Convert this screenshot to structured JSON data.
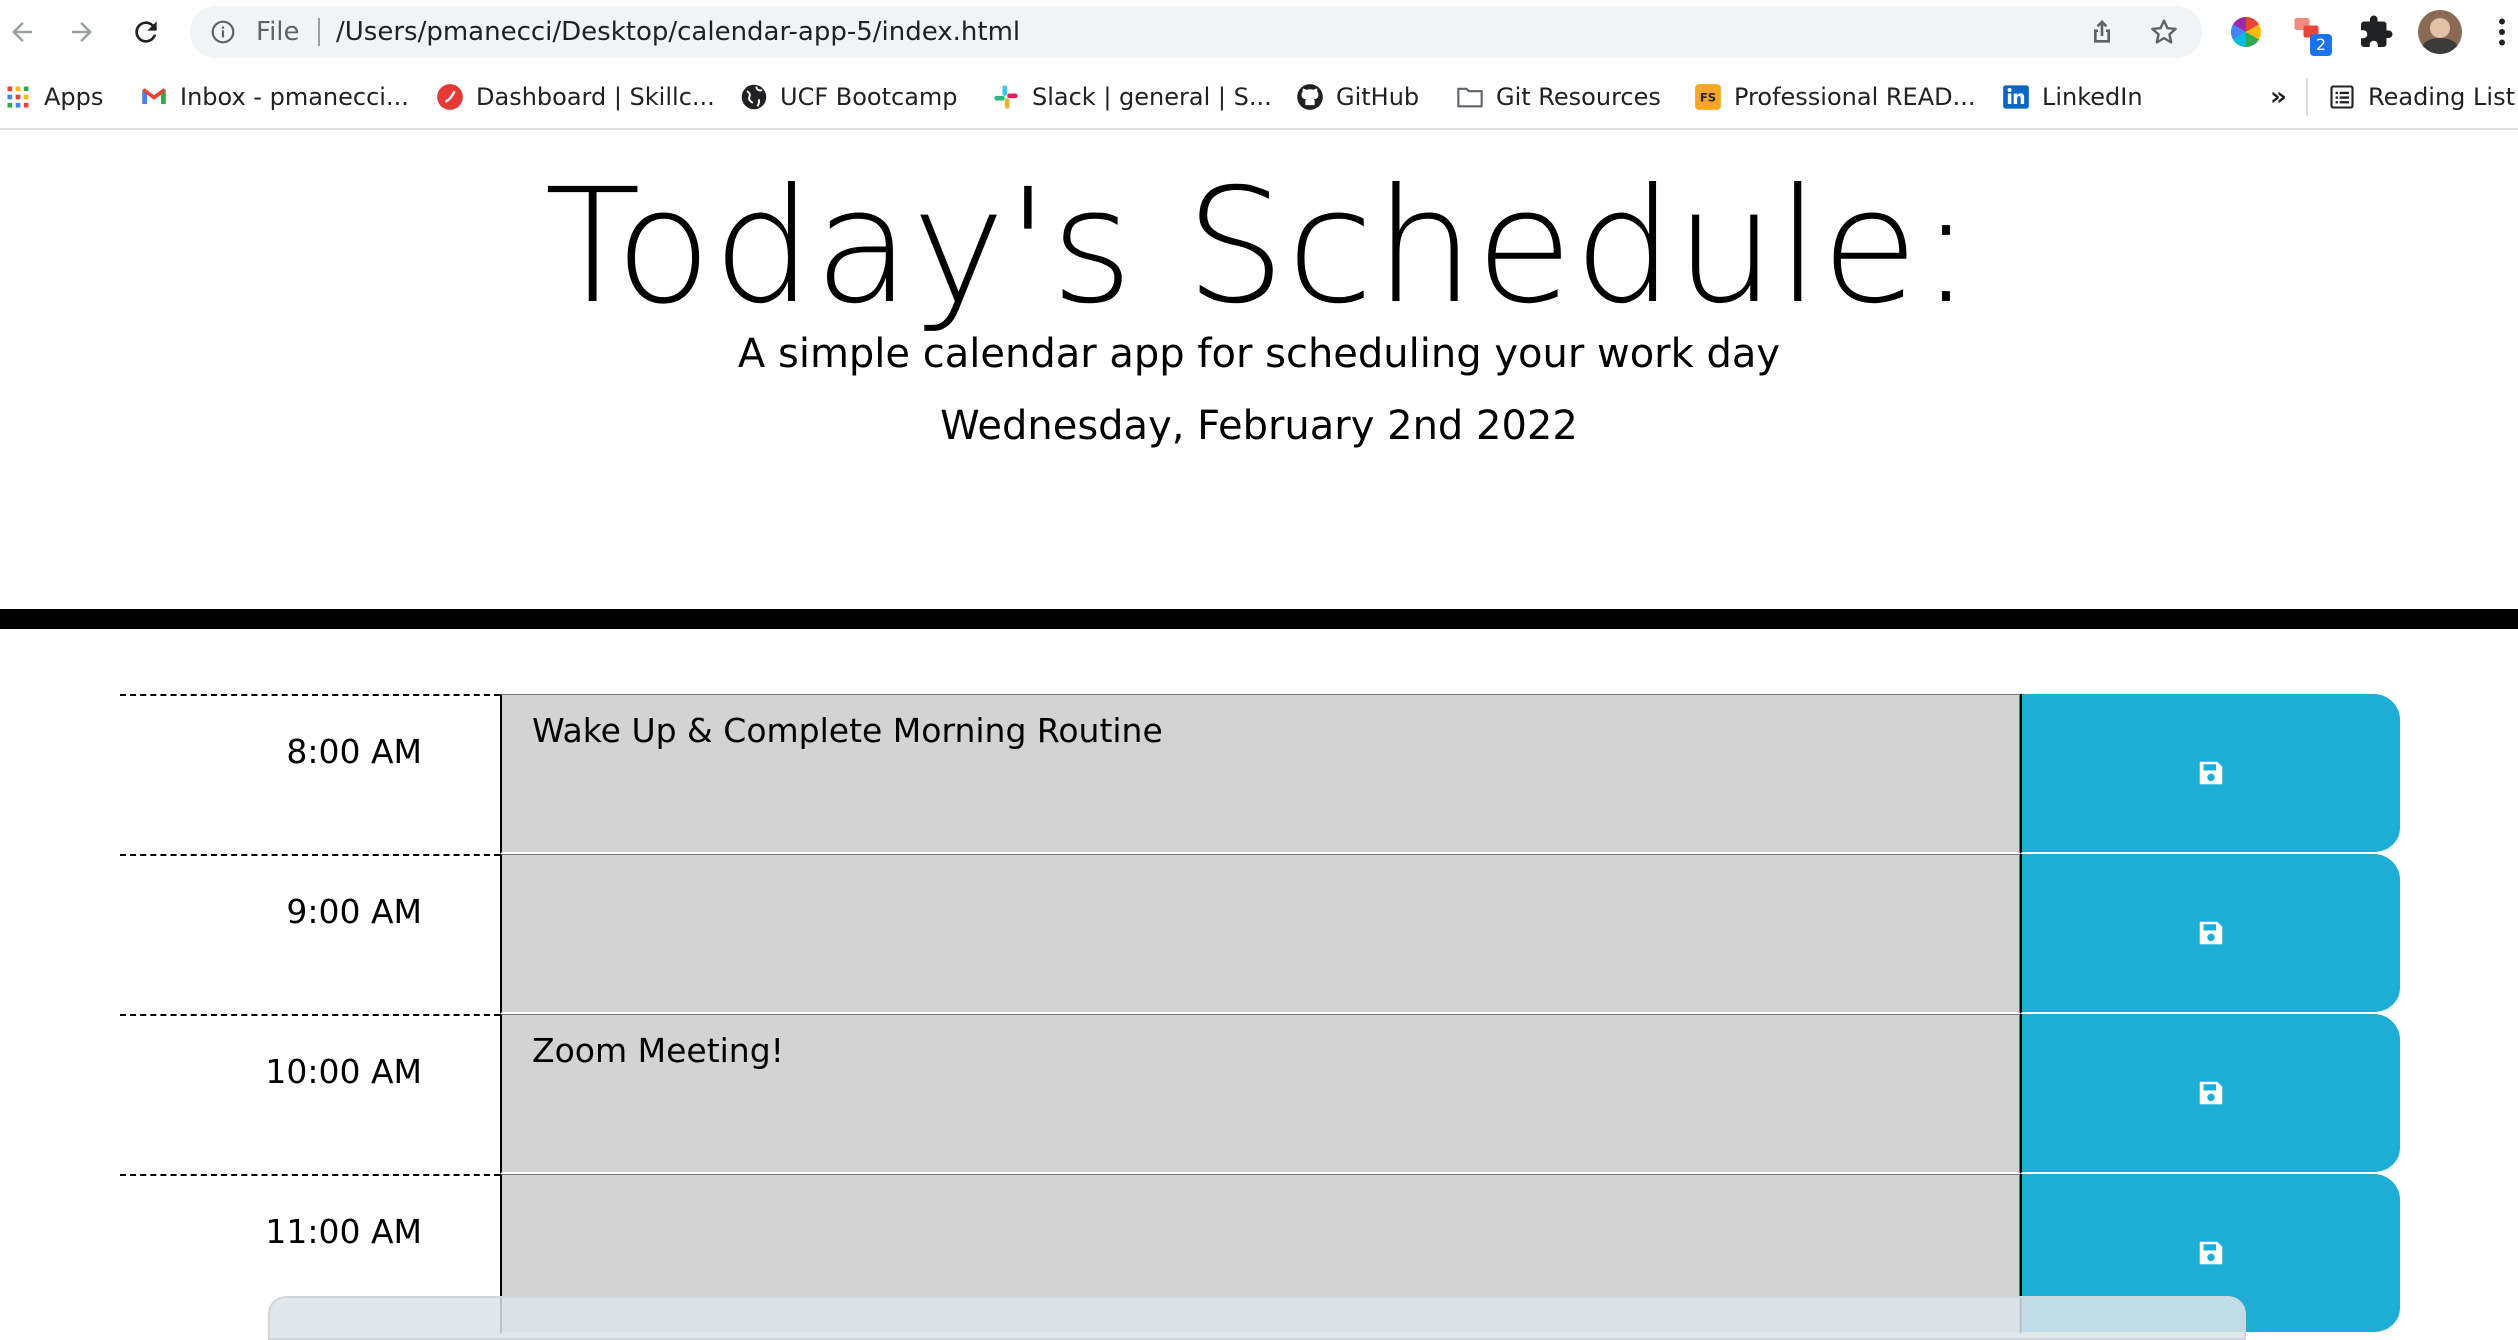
{
  "browser": {
    "url_scheme_label": "File",
    "url": "/Users/pmanecci/Desktop/calendar-app-5/index.html",
    "extension_badge": "2",
    "more_label": "»",
    "bookmarks": [
      {
        "label": "Apps",
        "icon": "apps-grid-icon"
      },
      {
        "label": "Inbox - pmanecci...",
        "icon": "gmail-icon"
      },
      {
        "label": "Dashboard | Skillc...",
        "icon": "skillcrush-icon"
      },
      {
        "label": "UCF Bootcamp",
        "icon": "globe-icon"
      },
      {
        "label": "Slack | general | S...",
        "icon": "slack-icon"
      },
      {
        "label": "GitHub",
        "icon": "github-icon"
      },
      {
        "label": "Git Resources",
        "icon": "folder-icon"
      },
      {
        "label": "Professional READ...",
        "icon": "fs-icon"
      },
      {
        "label": "LinkedIn",
        "icon": "linkedin-icon"
      }
    ],
    "reading_list_label": "Reading List"
  },
  "page": {
    "title": "Today's Schedule:",
    "lead": "A simple calendar app for scheduling your work day",
    "current_day": "Wednesday, February 2nd 2022"
  },
  "schedule": [
    {
      "hour": "8:00 AM",
      "text": "Wake Up & Complete Morning Routine"
    },
    {
      "hour": "9:00 AM",
      "text": ""
    },
    {
      "hour": "10:00 AM",
      "text": "Zoom Meeting!"
    },
    {
      "hour": "11:00 AM",
      "text": ""
    }
  ],
  "colors": {
    "save_button": "#1eadd4",
    "row_past": "#d3d3d3",
    "divider": "#000000"
  }
}
